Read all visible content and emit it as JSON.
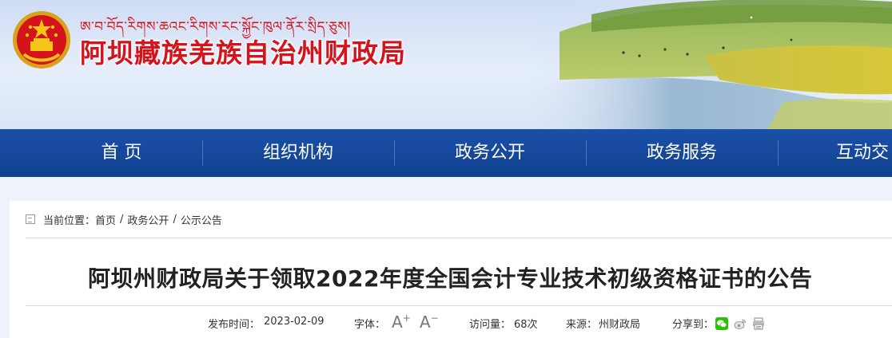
{
  "header": {
    "tibetan_name": "ཨ་བ་བོད་རིགས་ཆའང་རིགས་རང་སྐྱོང་ཁུལ་ནོར་སྲིད་ཅུས།",
    "bureau_name": "阿坝藏族羌族自治州财政局",
    "emblem_icon": "national-emblem-icon"
  },
  "nav": {
    "items": [
      {
        "label": "首  页"
      },
      {
        "label": "组织机构"
      },
      {
        "label": "政务公开"
      },
      {
        "label": "政务服务"
      },
      {
        "label": "互动交"
      }
    ]
  },
  "breadcrumb": {
    "prefix": "当前位置：",
    "items": [
      "首页",
      "政务公开",
      "公示公告"
    ],
    "separator": "/"
  },
  "article": {
    "title": "阿坝州财政局关于领取2022年度全国会计专业技术初级资格证书的公告",
    "publish_label": "发布时间：",
    "publish_date": "2023-02-09",
    "font_label": "字体：",
    "font_increase": "A",
    "font_decrease": "A",
    "views_label": "访问量：",
    "views_value": "68次",
    "source_label": "来源：",
    "source_value": "州财政局",
    "share_label": "分享到："
  },
  "colors": {
    "brand_red": "#d4131b",
    "nav_blue": "#1b50a8",
    "wechat_green": "#2dc100"
  },
  "share_icons": [
    "wechat-icon",
    "weibo-icon",
    "print-icon"
  ]
}
